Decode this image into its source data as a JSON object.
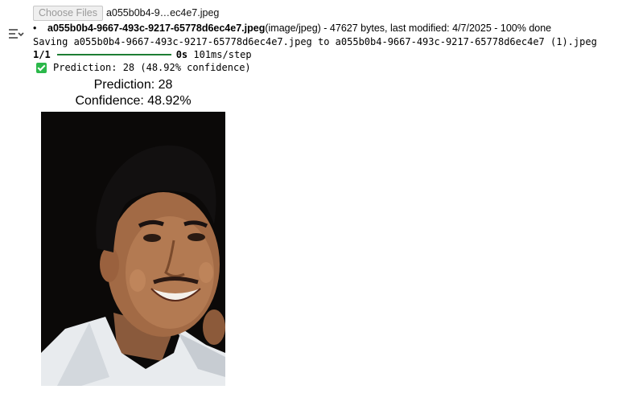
{
  "file_input": {
    "button_label": "Choose Files",
    "chosen_text": "a055b0b4-9…ec4e7.jpeg"
  },
  "upload": {
    "filename": "a055b0b4-9667-493c-9217-65778d6ec4e7.jpeg",
    "mime": "(image/jpeg)",
    "details": " - 47627 bytes, last modified: 4/7/2025 - 100% done",
    "saving_line": "Saving a055b0b4-9667-493c-9217-65778d6ec4e7.jpeg to a055b0b4-9667-493c-9217-65778d6ec4e7 (1).jpeg"
  },
  "progress": {
    "step": "1/1",
    "time": "0s",
    "rate": " 101ms/step",
    "fraction": 1.0,
    "color": "#1e7e34"
  },
  "prediction_line": "Prediction: 28 (48.92% confidence)",
  "figure": {
    "title_line1": "Prediction: 28",
    "title_line2": "Confidence: 48.92%"
  },
  "icons": {
    "toggle": "output-collapse-icon",
    "check": "check-icon"
  }
}
